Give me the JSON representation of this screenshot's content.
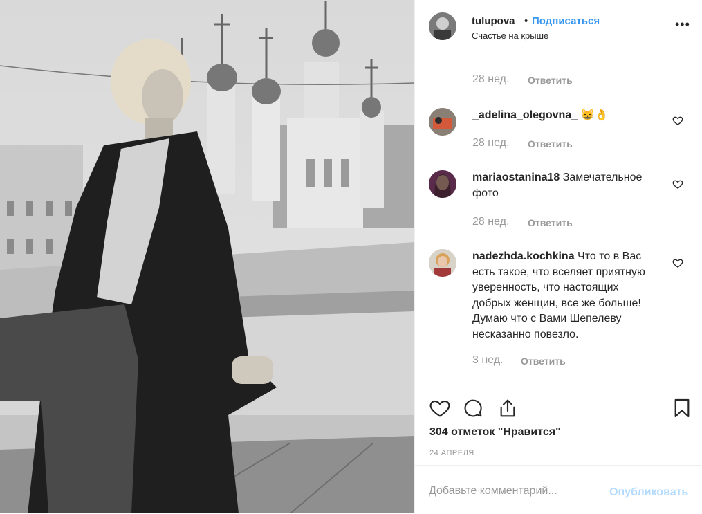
{
  "header": {
    "username": "tulupova",
    "separator": "•",
    "follow_label": "Подписаться",
    "location": "Счастье на крыше",
    "more_icon": "more-horizontal-icon"
  },
  "comments": [
    {
      "username": "",
      "text": "",
      "time": "28 нед.",
      "reply": "Ответить"
    },
    {
      "username": "_adelina_olegovna_",
      "text": "😸👌",
      "time": "28 нед.",
      "reply": "Ответить"
    },
    {
      "username": "mariaostanina18",
      "text": "Замечательное фото",
      "time": "28 нед.",
      "reply": "Ответить"
    },
    {
      "username": "nadezhda.kochkina",
      "text": "Что то в Вас есть такое, что вселяет приятную уверенность, что настоящих добрых женщин, все же больше! Думаю что с Вами Шепелеву несказанно повезло.",
      "time": "3 нед.",
      "reply": "Ответить"
    }
  ],
  "actions": {
    "like_icon": "heart-icon",
    "comment_icon": "comment-bubble-icon",
    "share_icon": "share-icon",
    "save_icon": "bookmark-icon"
  },
  "likes": "304 отметок \"Нравится\"",
  "date": "24 АПРЕЛЯ",
  "add_comment": {
    "placeholder": "Добавьте комментарий...",
    "post_label": "Опубликовать"
  },
  "colors": {
    "link": "#3897f0",
    "muted": "#999999",
    "post_disabled": "#b3dbff",
    "text": "#262626"
  }
}
